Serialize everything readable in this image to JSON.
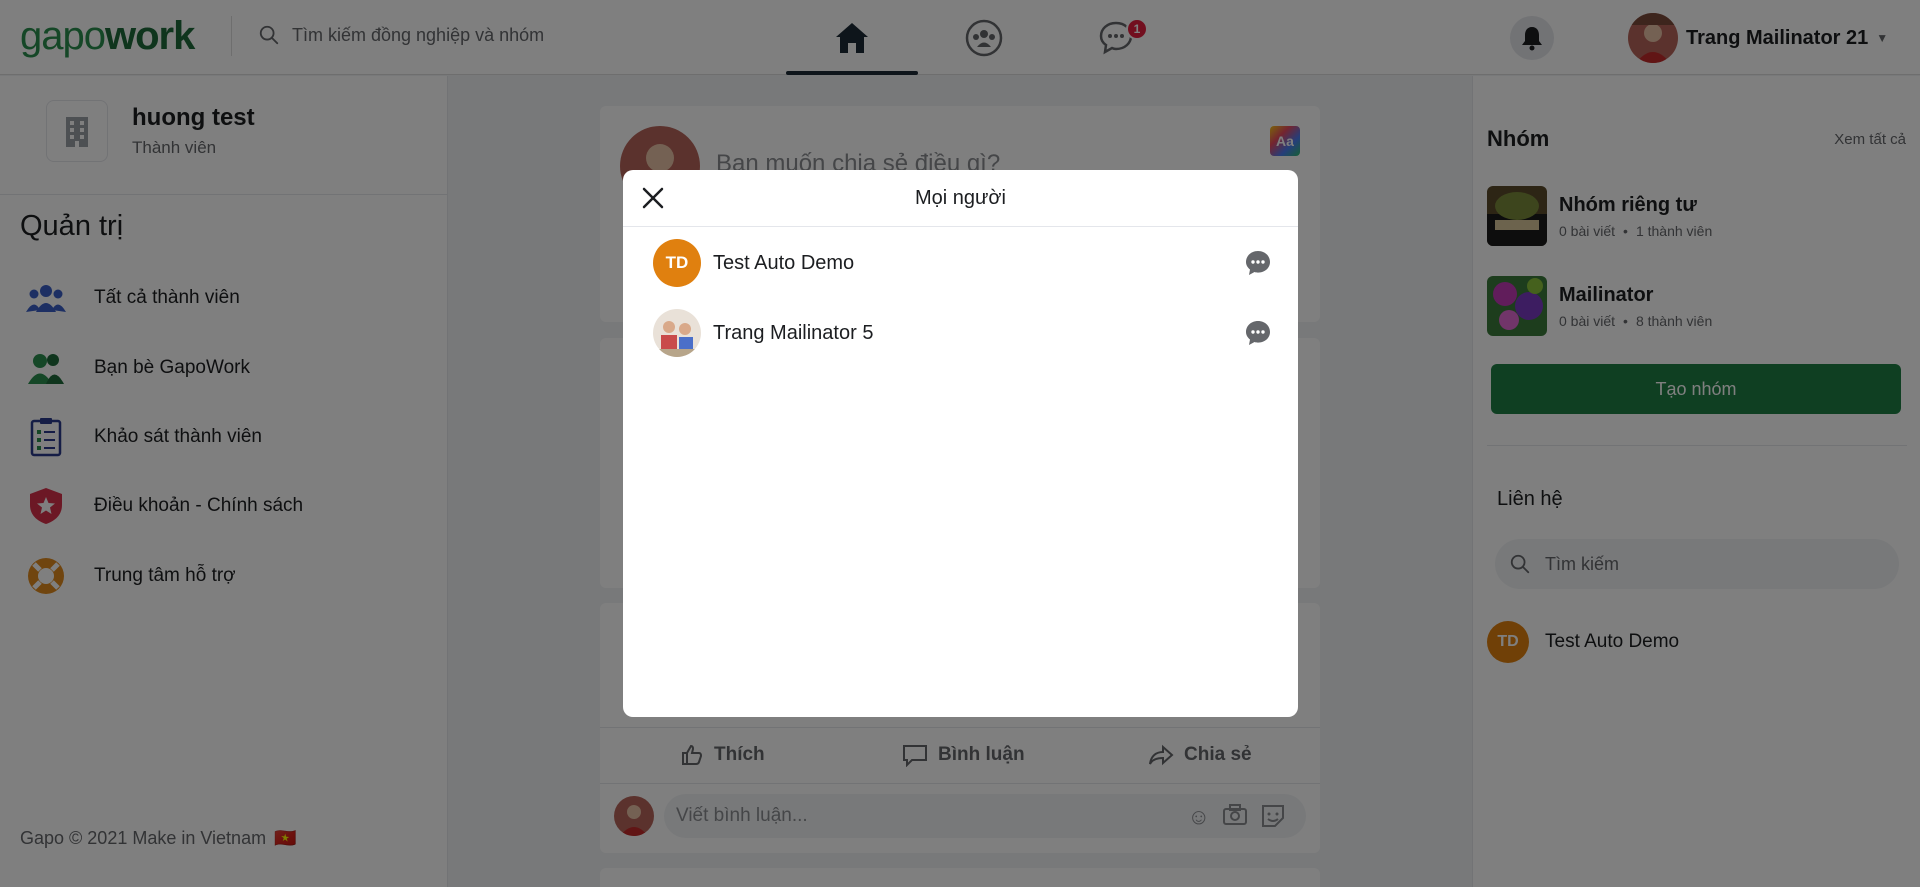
{
  "header": {
    "logo_part1": "gapo",
    "logo_part2": "work",
    "search_placeholder": "Tìm kiếm đồng nghiệp và nhóm",
    "messages_badge": "1",
    "user_name": "Trang Mailinator 21"
  },
  "left": {
    "org_name": "huong test",
    "org_role": "Thành viên",
    "section_title": "Quản trị",
    "menu": [
      {
        "label": "Tất cả thành viên"
      },
      {
        "label": "Bạn bè GapoWork"
      },
      {
        "label": "Khảo sát thành viên"
      },
      {
        "label": "Điều khoản - Chính sách"
      },
      {
        "label": "Trung tâm hỗ trợ"
      }
    ],
    "footer": "Gapo © 2021 Make in Vietnam",
    "footer_flag": "🇻🇳"
  },
  "composer": {
    "placeholder": "Bạn muốn chia sẻ điều gì?",
    "format_label": "Aa"
  },
  "post": {
    "like": "Thích",
    "comment": "Bình luận",
    "share": "Chia sẻ",
    "comment_placeholder": "Viết bình luận..."
  },
  "right": {
    "groups_title": "Nhóm",
    "see_all": "Xem tất cả",
    "groups": [
      {
        "name": "Nhóm riêng tư",
        "posts": "0 bài viết",
        "members": "1 thành viên"
      },
      {
        "name": "Mailinator",
        "posts": "0 bài viết",
        "members": "8 thành viên"
      }
    ],
    "create_group": "Tạo nhóm",
    "contacts_title": "Liên hệ",
    "contacts_search": "Tìm kiếm",
    "contacts": [
      {
        "initials": "TD",
        "name": "Test Auto Demo"
      }
    ]
  },
  "modal": {
    "title": "Mọi người",
    "people": [
      {
        "initials": "TD",
        "name": "Test Auto Demo"
      },
      {
        "initials": "",
        "name": "Trang Mailinator 5"
      }
    ]
  },
  "colors": {
    "brand_green": "#1e7e45",
    "badge_red": "#e41e3f",
    "avatar_orange": "#e0800f"
  }
}
